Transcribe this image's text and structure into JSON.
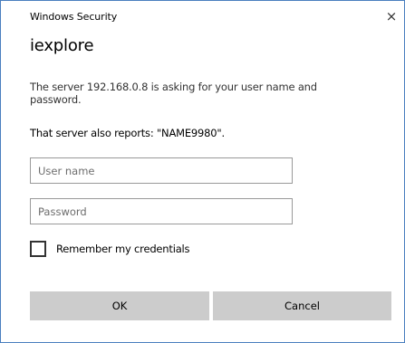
{
  "window": {
    "title": "Windows Security",
    "close_glyph": "×"
  },
  "dialog": {
    "app_name": "iexplore",
    "message": "The server 192.168.0.8 is asking for your user name and password.",
    "report": "That server also reports: \"NAME9980\".",
    "username": {
      "placeholder": "User name",
      "value": ""
    },
    "password": {
      "placeholder": "Password",
      "value": ""
    },
    "remember": {
      "label": "Remember my credentials",
      "checked": false
    },
    "buttons": {
      "ok_label": "OK",
      "cancel_label": "Cancel"
    }
  },
  "colors": {
    "border": "#4a7fbf",
    "button_bg": "#cccccc",
    "field_border": "#999999"
  }
}
